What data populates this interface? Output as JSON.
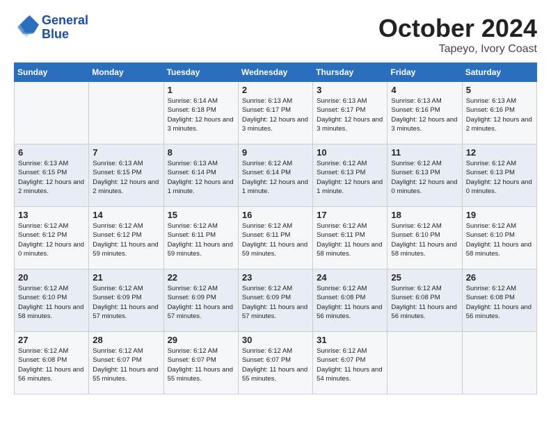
{
  "header": {
    "logo_line1": "General",
    "logo_line2": "Blue",
    "month": "October 2024",
    "location": "Tapeyo, Ivory Coast"
  },
  "days_of_week": [
    "Sunday",
    "Monday",
    "Tuesday",
    "Wednesday",
    "Thursday",
    "Friday",
    "Saturday"
  ],
  "weeks": [
    [
      {
        "day": "",
        "info": ""
      },
      {
        "day": "",
        "info": ""
      },
      {
        "day": "1",
        "info": "Sunrise: 6:14 AM\nSunset: 6:18 PM\nDaylight: 12 hours and 3 minutes."
      },
      {
        "day": "2",
        "info": "Sunrise: 6:13 AM\nSunset: 6:17 PM\nDaylight: 12 hours and 3 minutes."
      },
      {
        "day": "3",
        "info": "Sunrise: 6:13 AM\nSunset: 6:17 PM\nDaylight: 12 hours and 3 minutes."
      },
      {
        "day": "4",
        "info": "Sunrise: 6:13 AM\nSunset: 6:16 PM\nDaylight: 12 hours and 3 minutes."
      },
      {
        "day": "5",
        "info": "Sunrise: 6:13 AM\nSunset: 6:16 PM\nDaylight: 12 hours and 2 minutes."
      }
    ],
    [
      {
        "day": "6",
        "info": "Sunrise: 6:13 AM\nSunset: 6:15 PM\nDaylight: 12 hours and 2 minutes."
      },
      {
        "day": "7",
        "info": "Sunrise: 6:13 AM\nSunset: 6:15 PM\nDaylight: 12 hours and 2 minutes."
      },
      {
        "day": "8",
        "info": "Sunrise: 6:13 AM\nSunset: 6:14 PM\nDaylight: 12 hours and 1 minute."
      },
      {
        "day": "9",
        "info": "Sunrise: 6:12 AM\nSunset: 6:14 PM\nDaylight: 12 hours and 1 minute."
      },
      {
        "day": "10",
        "info": "Sunrise: 6:12 AM\nSunset: 6:13 PM\nDaylight: 12 hours and 1 minute."
      },
      {
        "day": "11",
        "info": "Sunrise: 6:12 AM\nSunset: 6:13 PM\nDaylight: 12 hours and 0 minutes."
      },
      {
        "day": "12",
        "info": "Sunrise: 6:12 AM\nSunset: 6:13 PM\nDaylight: 12 hours and 0 minutes."
      }
    ],
    [
      {
        "day": "13",
        "info": "Sunrise: 6:12 AM\nSunset: 6:12 PM\nDaylight: 12 hours and 0 minutes."
      },
      {
        "day": "14",
        "info": "Sunrise: 6:12 AM\nSunset: 6:12 PM\nDaylight: 11 hours and 59 minutes."
      },
      {
        "day": "15",
        "info": "Sunrise: 6:12 AM\nSunset: 6:11 PM\nDaylight: 11 hours and 59 minutes."
      },
      {
        "day": "16",
        "info": "Sunrise: 6:12 AM\nSunset: 6:11 PM\nDaylight: 11 hours and 59 minutes."
      },
      {
        "day": "17",
        "info": "Sunrise: 6:12 AM\nSunset: 6:11 PM\nDaylight: 11 hours and 58 minutes."
      },
      {
        "day": "18",
        "info": "Sunrise: 6:12 AM\nSunset: 6:10 PM\nDaylight: 11 hours and 58 minutes."
      },
      {
        "day": "19",
        "info": "Sunrise: 6:12 AM\nSunset: 6:10 PM\nDaylight: 11 hours and 58 minutes."
      }
    ],
    [
      {
        "day": "20",
        "info": "Sunrise: 6:12 AM\nSunset: 6:10 PM\nDaylight: 11 hours and 58 minutes."
      },
      {
        "day": "21",
        "info": "Sunrise: 6:12 AM\nSunset: 6:09 PM\nDaylight: 11 hours and 57 minutes."
      },
      {
        "day": "22",
        "info": "Sunrise: 6:12 AM\nSunset: 6:09 PM\nDaylight: 11 hours and 57 minutes."
      },
      {
        "day": "23",
        "info": "Sunrise: 6:12 AM\nSunset: 6:09 PM\nDaylight: 11 hours and 57 minutes."
      },
      {
        "day": "24",
        "info": "Sunrise: 6:12 AM\nSunset: 6:08 PM\nDaylight: 11 hours and 56 minutes."
      },
      {
        "day": "25",
        "info": "Sunrise: 6:12 AM\nSunset: 6:08 PM\nDaylight: 11 hours and 56 minutes."
      },
      {
        "day": "26",
        "info": "Sunrise: 6:12 AM\nSunset: 6:08 PM\nDaylight: 11 hours and 56 minutes."
      }
    ],
    [
      {
        "day": "27",
        "info": "Sunrise: 6:12 AM\nSunset: 6:08 PM\nDaylight: 11 hours and 56 minutes."
      },
      {
        "day": "28",
        "info": "Sunrise: 6:12 AM\nSunset: 6:07 PM\nDaylight: 11 hours and 55 minutes."
      },
      {
        "day": "29",
        "info": "Sunrise: 6:12 AM\nSunset: 6:07 PM\nDaylight: 11 hours and 55 minutes."
      },
      {
        "day": "30",
        "info": "Sunrise: 6:12 AM\nSunset: 6:07 PM\nDaylight: 11 hours and 55 minutes."
      },
      {
        "day": "31",
        "info": "Sunrise: 6:12 AM\nSunset: 6:07 PM\nDaylight: 11 hours and 54 minutes."
      },
      {
        "day": "",
        "info": ""
      },
      {
        "day": "",
        "info": ""
      }
    ]
  ]
}
